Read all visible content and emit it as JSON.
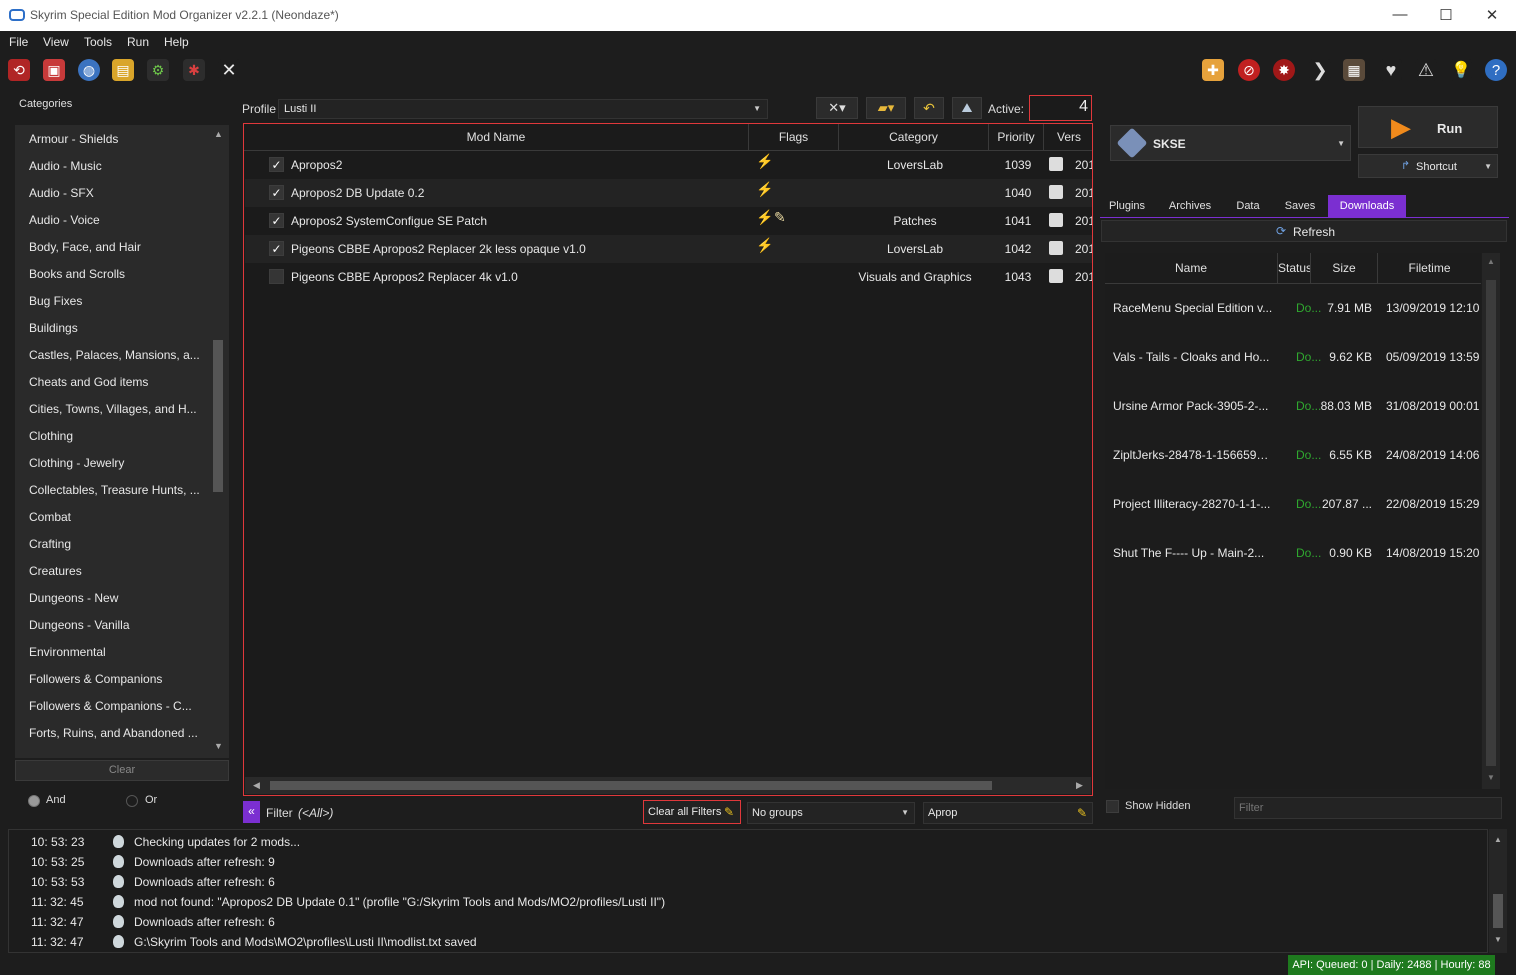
{
  "window": {
    "title": "Skyrim Special Edition Mod Organizer v2.2.1 (Neondaze*)",
    "minimize": "—",
    "maximize": "☐",
    "close": "✕"
  },
  "menu": [
    "File",
    "View",
    "Tools",
    "Run",
    "Help"
  ],
  "categories": {
    "label": "Categories",
    "items": [
      "Armour - Shields",
      "Audio - Music",
      "Audio - SFX",
      "Audio - Voice",
      "Body, Face, and Hair",
      "Books and Scrolls",
      "Bug Fixes",
      "Buildings",
      "Castles, Palaces, Mansions, a...",
      "Cheats and God items",
      "Cities, Towns, Villages, and H...",
      "Clothing",
      "Clothing - Jewelry",
      "Collectables, Treasure Hunts, ...",
      "Combat",
      "Crafting",
      "Creatures",
      "Dungeons - New",
      "Dungeons - Vanilla",
      "Environmental",
      "Followers & Companions",
      "Followers & Companions - C...",
      "Forts, Ruins, and Abandoned ..."
    ],
    "clear_label": "Clear",
    "and_label": "And",
    "or_label": "Or"
  },
  "profile": {
    "label": "Profile",
    "value": "Lusti II",
    "active_label": "Active:",
    "active_value": "4"
  },
  "modlist": {
    "columns": {
      "name": "Mod Name",
      "flags": "Flags",
      "category": "Category",
      "priority": "Priority",
      "version": "Vers"
    },
    "rows": [
      {
        "checked": "✓",
        "name": "Apropos2",
        "category": "LoversLab",
        "priority": "1039",
        "version": "201"
      },
      {
        "checked": "✓",
        "name": "Apropos2 DB Update 0.2",
        "category": "",
        "priority": "1040",
        "version": "201"
      },
      {
        "checked": "✓",
        "name": "Apropos2 SystemConfigue SE Patch",
        "category": "Patches",
        "priority": "1041",
        "version": "201"
      },
      {
        "checked": "✓",
        "name": "Pigeons CBBE Apropos2 Replacer 2k less opaque v1.0",
        "category": "LoversLab",
        "priority": "1042",
        "version": "201"
      },
      {
        "checked": "",
        "name": "Pigeons CBBE Apropos2 Replacer 4k v1.0",
        "category": "Visuals and Graphics",
        "priority": "1043",
        "version": "201"
      }
    ]
  },
  "filterbar": {
    "toggle": "«",
    "filter_label": "Filter",
    "filter_value": "(<All>)",
    "clear_filters": "Clear all Filters",
    "groups": "No groups",
    "search": "Aprop"
  },
  "run": {
    "executable": "SKSE",
    "run_label": "Run",
    "shortcut_label": "Shortcut"
  },
  "tabs": [
    "Plugins",
    "Archives",
    "Data",
    "Saves",
    "Downloads"
  ],
  "downloads": {
    "refresh": "Refresh",
    "columns": {
      "name": "Name",
      "status": "Status",
      "size": "Size",
      "filetime": "Filetime"
    },
    "rows": [
      {
        "name": "RaceMenu Special Edition v...",
        "status": "Do...",
        "size": "7.91 MB",
        "time": "13/09/2019 12:10"
      },
      {
        "name": "Vals - Tails - Cloaks and Ho...",
        "status": "Do...",
        "size": "9.62 KB",
        "time": "05/09/2019 13:59"
      },
      {
        "name": "Ursine Armor Pack-3905-2-...",
        "status": "Do...",
        "size": "88.03 MB",
        "time": "31/08/2019 00:01"
      },
      {
        "name": "ZipltJerks-28478-1-1566593...",
        "status": "Do...",
        "size": "6.55 KB",
        "time": "24/08/2019 14:06"
      },
      {
        "name": "Project Illiteracy-28270-1-1-...",
        "status": "Do...",
        "size": "207.87 ...",
        "time": "22/08/2019 15:29"
      },
      {
        "name": "Shut The F---- Up - Main-2...",
        "status": "Do...",
        "size": "0.90 KB",
        "time": "14/08/2019 15:20"
      }
    ],
    "show_hidden": "Show Hidden",
    "filter_placeholder": "Filter"
  },
  "log": [
    {
      "time": "10: 53: 23",
      "text": "Checking updates for 2 mods..."
    },
    {
      "time": "10: 53: 25",
      "text": "Downloads after refresh: 9"
    },
    {
      "time": "10: 53: 53",
      "text": "Downloads after refresh: 6"
    },
    {
      "time": "11: 32: 45",
      "text": "mod not found: \"Apropos2 DB Update 0.1\" (profile \"G:/Skyrim Tools and Mods/MO2/profiles/Lusti II\")"
    },
    {
      "time": "11: 32: 47",
      "text": "Downloads after refresh: 6"
    },
    {
      "time": "11: 32: 47",
      "text": "G:\\Skyrim Tools and Mods\\MO2\\profiles\\Lusti II\\modlist.txt saved"
    }
  ],
  "status": "API: Queued: 0 | Daily: 2488 | Hourly: 88"
}
